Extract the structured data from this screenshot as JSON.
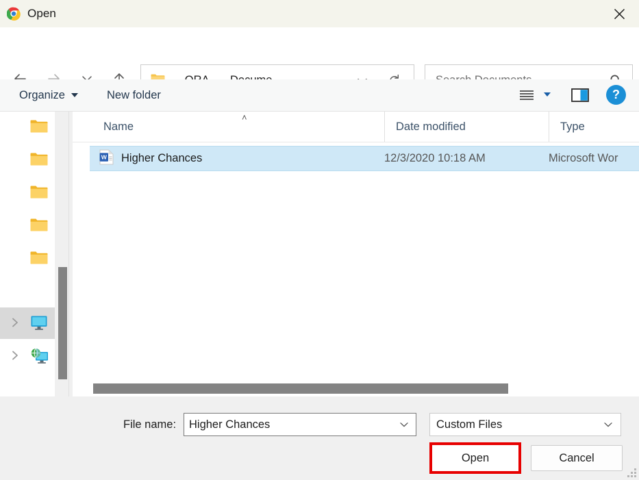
{
  "window": {
    "title": "Open",
    "app_icon": "chrome-logo-icon",
    "close_label": "✕",
    "titlebar_bg": "#f4f4ec"
  },
  "nav": {
    "back": "back-arrow-icon",
    "forward": "forward-arrow-icon",
    "recent": "chevron-down-icon",
    "up": "up-arrow-icon"
  },
  "address": {
    "folder_icon": "folder-icon",
    "prefix": "«",
    "crumb1": "ORA...",
    "separator": "›",
    "crumb2": "Docume...",
    "dropdown_icon": "chevron-down-icon",
    "refresh_icon": "refresh-icon"
  },
  "search": {
    "placeholder": "Search Documents",
    "value": "",
    "icon": "search-icon"
  },
  "toolbar": {
    "organize_label": "Organize",
    "new_folder_label": "New folder",
    "view_icon": "list-view-icon",
    "preview_icon": "preview-pane-icon",
    "help_label": "?"
  },
  "sidebar": {
    "items": [
      {
        "icon": "folder-icon",
        "label": "",
        "expandable": false,
        "selected": false
      },
      {
        "icon": "folder-icon",
        "label": "",
        "expandable": false,
        "selected": false
      },
      {
        "icon": "folder-icon",
        "label": "",
        "expandable": false,
        "selected": false
      },
      {
        "icon": "folder-icon",
        "label": "",
        "expandable": false,
        "selected": false
      },
      {
        "icon": "folder-icon",
        "label": "",
        "expandable": false,
        "selected": false
      },
      {
        "icon": "this-pc-icon",
        "label": "",
        "expandable": true,
        "selected": true
      },
      {
        "icon": "network-icon",
        "label": "",
        "expandable": true,
        "selected": false
      }
    ]
  },
  "filelist": {
    "columns": [
      "Name",
      "Date modified",
      "Type"
    ],
    "sort_indicator": "˄",
    "rows": [
      {
        "icon": "word-document-icon",
        "name": "Higher Chances",
        "date_modified": "12/3/2020 10:18 AM",
        "type": "Microsoft Wor",
        "selected": true
      }
    ]
  },
  "footer": {
    "filename_label": "File name:",
    "filename_value": "Higher Chances",
    "filetype_value": "Custom Files",
    "dropdown_icon": "chevron-down-icon",
    "open_label": "Open",
    "cancel_label": "Cancel",
    "highlight_color": "#e70000"
  }
}
